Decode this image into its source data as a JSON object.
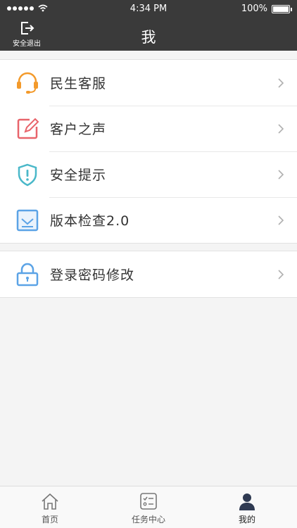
{
  "status": {
    "time": "4:34 PM",
    "battery": "100%",
    "signal_dots": 5,
    "battery_level": 1.0
  },
  "nav": {
    "logout_label": "安全退出",
    "title": "我"
  },
  "menu_group_1": [
    {
      "label": "民生客服",
      "icon": "headset-icon",
      "color": "#f39a2b"
    },
    {
      "label": "客户之声",
      "icon": "edit-icon",
      "color": "#e8646b"
    },
    {
      "label": "安全提示",
      "icon": "shield-icon",
      "color": "#4ab8c9"
    },
    {
      "label": "版本检查2.0",
      "icon": "inbox-icon",
      "color": "#5ba3e6"
    }
  ],
  "menu_group_2": [
    {
      "label": "登录密码修改",
      "icon": "lock-icon",
      "color": "#5ba3e6"
    }
  ],
  "tabs": [
    {
      "label": "首页",
      "icon": "home-icon"
    },
    {
      "label": "任务中心",
      "icon": "task-list-icon"
    },
    {
      "label": "我的",
      "icon": "person-icon",
      "active": true
    }
  ]
}
